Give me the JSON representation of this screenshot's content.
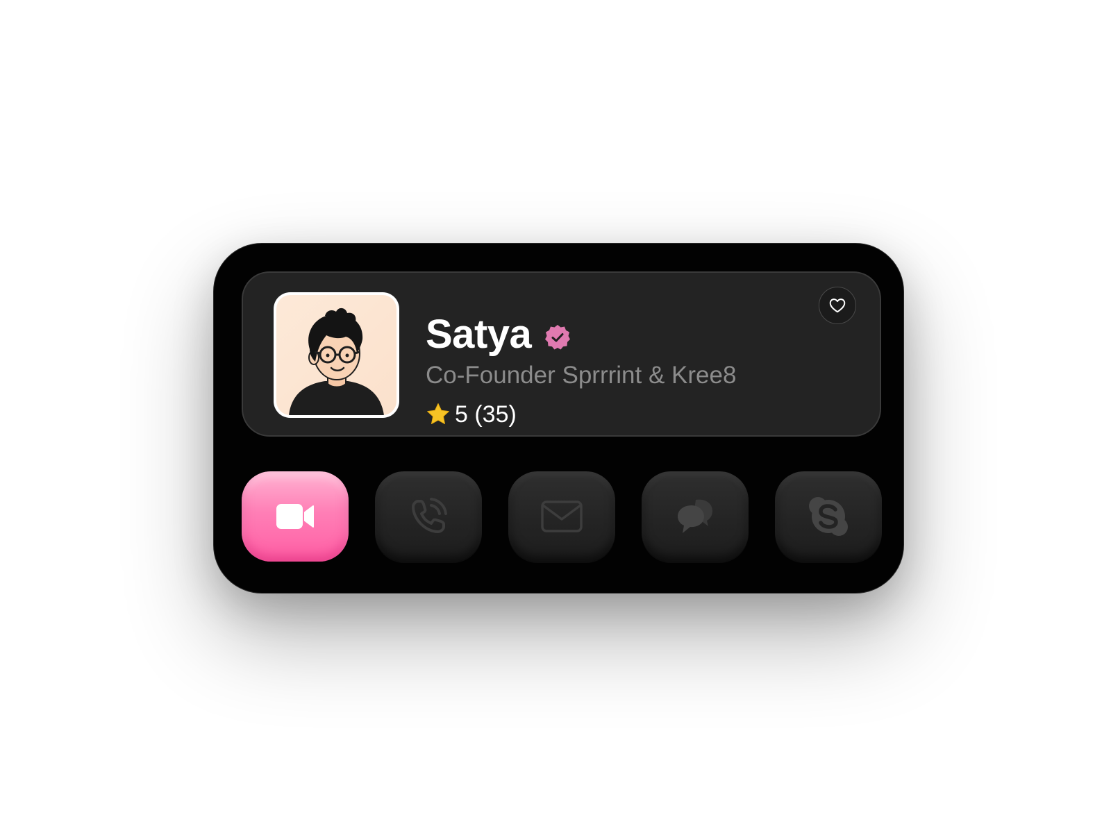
{
  "profile": {
    "name": "Satya",
    "title": "Co-Founder Sprrrint & Kree8",
    "rating": "5 (35)",
    "icons": {
      "verified": "verified-badge-icon",
      "star": "star-icon",
      "favorite": "heart-outline-icon"
    }
  },
  "actions": [
    {
      "id": "video",
      "icon": "video-camera-icon",
      "active": true
    },
    {
      "id": "call",
      "icon": "phone-call-icon",
      "active": false
    },
    {
      "id": "email",
      "icon": "envelope-icon",
      "active": false
    },
    {
      "id": "chat",
      "icon": "chat-bubbles-icon",
      "active": false
    },
    {
      "id": "skype",
      "icon": "skype-icon",
      "active": false
    }
  ],
  "colors": {
    "accent": "#ff6fad",
    "verified": "#e07ab0",
    "star": "#f7c325",
    "card_bg": "#232323",
    "widget_bg": "#020202",
    "title_text": "#8c8c8c"
  }
}
